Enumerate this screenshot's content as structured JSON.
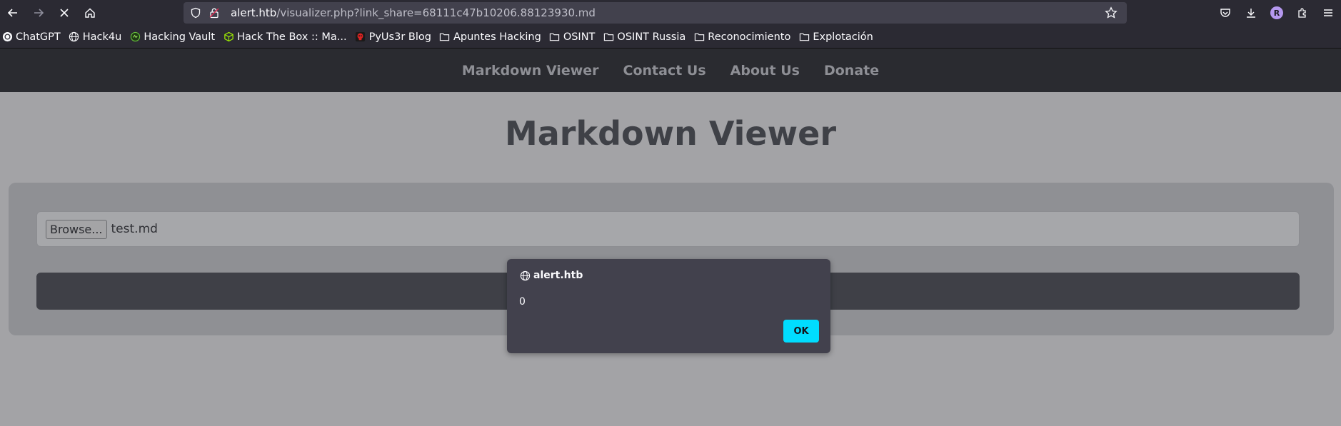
{
  "browser": {
    "url_host": "alert.htb",
    "url_path": "/visualizer.php?link_share=68111c47b10206.88123930.md",
    "avatar_letter": "R",
    "accent_color": "#00ddff"
  },
  "bookmarks": [
    {
      "label": "ChatGPT",
      "icon": "chatgpt-icon"
    },
    {
      "label": "Hack4u",
      "icon": "globe-icon"
    },
    {
      "label": "Hacking Vault",
      "icon": "vault-icon"
    },
    {
      "label": "Hack The Box :: Ma...",
      "icon": "htb-cube-icon"
    },
    {
      "label": "PyUs3r Blog",
      "icon": "skull-icon"
    },
    {
      "label": "Apuntes Hacking",
      "icon": "folder-icon"
    },
    {
      "label": "OSINT",
      "icon": "folder-icon"
    },
    {
      "label": "OSINT Russia",
      "icon": "folder-icon"
    },
    {
      "label": "Reconocimiento",
      "icon": "folder-icon"
    },
    {
      "label": "Explotación",
      "icon": "folder-icon"
    }
  ],
  "site": {
    "nav": [
      "Markdown Viewer",
      "Contact Us",
      "About Us",
      "Donate"
    ],
    "title": "Markdown Viewer",
    "browse_label": "Browse...",
    "file_name": "test.md"
  },
  "dialog": {
    "origin": "alert.htb",
    "message": "0",
    "ok_label": "OK"
  }
}
